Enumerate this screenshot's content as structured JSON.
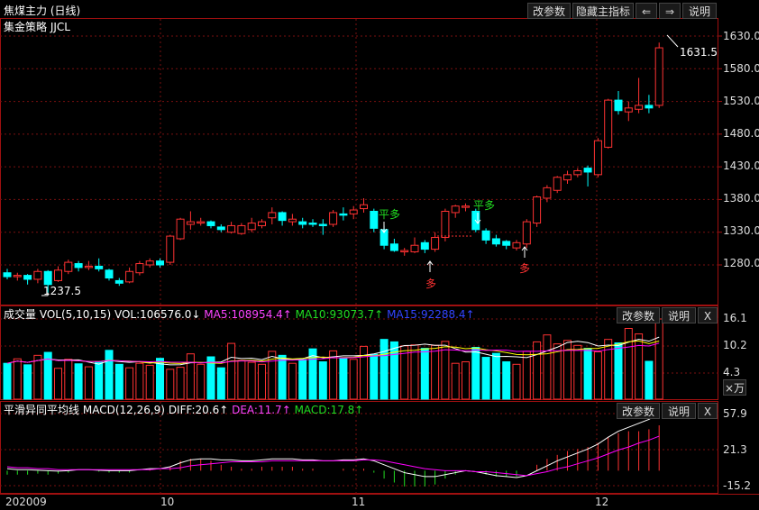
{
  "header": {
    "title": "焦煤主力 (日线)",
    "strategy": "集金策略 JJCL",
    "buttons": [
      "改参数",
      "隐藏主指标",
      "⇐",
      "⇒",
      "说明"
    ]
  },
  "price_axis": {
    "ticks": [
      "1630.0",
      "1580.0",
      "1530.0",
      "1480.0",
      "1430.0",
      "1380.0",
      "1330.0",
      "1280.0"
    ]
  },
  "annotations": {
    "high_label": "1631.5",
    "low_label": "1237.5",
    "signals": [
      {
        "text": "平多",
        "type": "exit"
      },
      {
        "text": "平多",
        "type": "exit"
      },
      {
        "text": "多",
        "type": "long"
      },
      {
        "text": "多",
        "type": "long"
      }
    ]
  },
  "volume_panel": {
    "title": "成交量",
    "indicator": "VOL(5,10,15)",
    "vol": "VOL:106576.0↓",
    "ma5": "MA5:108954.4↑",
    "ma10": "MA10:93073.7↑",
    "ma15": "MA15:92288.4↑",
    "buttons": [
      "改参数",
      "说明",
      "X"
    ],
    "ticks": [
      "16.1",
      "10.2",
      "4.3"
    ],
    "unit": "×万"
  },
  "macd_panel": {
    "title": "平滑异同平均线",
    "indicator": "MACD(12,26,9)",
    "diff": "DIFF:20.6↑",
    "dea": "DEA:11.7↑",
    "macd": "MACD:17.8↑",
    "buttons": [
      "改参数",
      "说明",
      "X"
    ],
    "ticks": [
      "57.9",
      "21.3",
      "-15.2"
    ]
  },
  "date_axis": {
    "labels": [
      "202009",
      "10",
      "11",
      "12"
    ]
  },
  "colors": {
    "up": "#ff3232",
    "down": "#00ffff",
    "ma5": "#ffffff",
    "ma10": "#ffff00",
    "ma15": "#ff00ff",
    "diff": "#ffffff",
    "dea": "#ff00ff",
    "grid": "#7a1010"
  },
  "chart_data": {
    "type": "candlestick",
    "price_range": [
      1230,
      1650
    ],
    "candles": [
      [
        1268,
        1262,
        1274,
        1258
      ],
      [
        1262,
        1264,
        1268,
        1256
      ],
      [
        1264,
        1258,
        1266,
        1250
      ],
      [
        1258,
        1270,
        1274,
        1252
      ],
      [
        1270,
        1250,
        1272,
        1237.5
      ],
      [
        1256,
        1272,
        1278,
        1254
      ],
      [
        1270,
        1284,
        1288,
        1266
      ],
      [
        1282,
        1276,
        1286,
        1270
      ],
      [
        1276,
        1278,
        1286,
        1272
      ],
      [
        1278,
        1274,
        1290,
        1270
      ],
      [
        1272,
        1260,
        1274,
        1256
      ],
      [
        1256,
        1252,
        1260,
        1248
      ],
      [
        1254,
        1270,
        1276,
        1252
      ],
      [
        1268,
        1282,
        1286,
        1264
      ],
      [
        1280,
        1286,
        1290,
        1276
      ],
      [
        1286,
        1280,
        1290,
        1276
      ],
      [
        1284,
        1324,
        1326,
        1280
      ],
      [
        1320,
        1350,
        1352,
        1318
      ],
      [
        1342,
        1346,
        1362,
        1334
      ],
      [
        1344,
        1346,
        1352,
        1340
      ],
      [
        1346,
        1340,
        1348,
        1336
      ],
      [
        1338,
        1334,
        1342,
        1330
      ],
      [
        1330,
        1340,
        1346,
        1328
      ],
      [
        1328,
        1340,
        1344,
        1326
      ],
      [
        1334,
        1344,
        1352,
        1330
      ],
      [
        1340,
        1346,
        1350,
        1336
      ],
      [
        1352,
        1360,
        1368,
        1342
      ],
      [
        1360,
        1348,
        1362,
        1340
      ],
      [
        1346,
        1350,
        1358,
        1340
      ],
      [
        1346,
        1342,
        1352,
        1336
      ],
      [
        1344,
        1342,
        1350,
        1338
      ],
      [
        1342,
        1340,
        1350,
        1326
      ],
      [
        1342,
        1360,
        1364,
        1338
      ],
      [
        1358,
        1356,
        1368,
        1348
      ],
      [
        1358,
        1364,
        1370,
        1350
      ],
      [
        1366,
        1372,
        1382,
        1360
      ],
      [
        1362,
        1336,
        1366,
        1330
      ],
      [
        1334,
        1310,
        1340,
        1304
      ],
      [
        1312,
        1302,
        1320,
        1300
      ],
      [
        1300,
        1302,
        1306,
        1294
      ],
      [
        1300,
        1310,
        1322,
        1298
      ],
      [
        1314,
        1304,
        1318,
        1298
      ],
      [
        1304,
        1322,
        1330,
        1300
      ],
      [
        1322,
        1362,
        1366,
        1316
      ],
      [
        1360,
        1370,
        1372,
        1352
      ],
      [
        1368,
        1370,
        1374,
        1362
      ],
      [
        1362,
        1334,
        1366,
        1330
      ],
      [
        1332,
        1318,
        1336,
        1312
      ],
      [
        1320,
        1312,
        1326,
        1308
      ],
      [
        1316,
        1310,
        1318,
        1304
      ],
      [
        1306,
        1314,
        1318,
        1302
      ],
      [
        1312,
        1346,
        1350,
        1306
      ],
      [
        1344,
        1384,
        1386,
        1338
      ],
      [
        1382,
        1398,
        1402,
        1376
      ],
      [
        1394,
        1414,
        1416,
        1390
      ],
      [
        1410,
        1418,
        1424,
        1404
      ],
      [
        1418,
        1424,
        1428,
        1414
      ],
      [
        1428,
        1422,
        1432,
        1400
      ],
      [
        1418,
        1470,
        1474,
        1414
      ],
      [
        1460,
        1532,
        1534,
        1458
      ],
      [
        1532,
        1516,
        1546,
        1510
      ],
      [
        1514,
        1520,
        1530,
        1500
      ],
      [
        1518,
        1524,
        1566,
        1512
      ],
      [
        1524,
        1520,
        1540,
        1512
      ],
      [
        1524,
        1612,
        1620,
        1520
      ]
    ],
    "volumes": [
      7.2,
      8.1,
      6.9,
      8.8,
      9.4,
      6.2,
      8.0,
      7.1,
      6.5,
      7.4,
      9.8,
      7.0,
      6.3,
      7.2,
      6.8,
      8.2,
      6.0,
      6.4,
      9.1,
      7.0,
      8.5,
      6.3,
      11.2,
      7.8,
      7.4,
      7.0,
      9.6,
      8.8,
      7.2,
      8.0,
      10.1,
      7.5,
      9.7,
      8.2,
      8.0,
      10.6,
      9.0,
      12.0,
      11.5,
      10.7,
      10.9,
      10.2,
      10.8,
      11.6,
      7.2,
      7.5,
      10.4,
      8.4,
      9.2,
      7.5,
      7.0,
      9.6,
      11.5,
      12.9,
      11.1,
      11.8,
      10.8,
      10.2,
      9.5,
      12.0,
      11.3,
      14.2,
      13.1,
      7.6,
      16.1
    ],
    "macd": {
      "diff": [
        2,
        1,
        1,
        0.5,
        0,
        -0.5,
        0,
        1,
        1,
        0.5,
        0,
        0,
        0,
        1,
        2,
        2,
        4,
        8,
        11,
        12,
        12,
        11,
        11,
        10,
        10,
        11,
        12,
        12,
        12,
        11,
        11,
        10,
        10,
        11,
        11,
        12,
        10,
        6,
        2,
        -2,
        -4,
        -6,
        -6,
        -4,
        -2,
        0,
        -1,
        -3,
        -5,
        -6,
        -7,
        -5,
        0,
        5,
        10,
        14,
        18,
        22,
        27,
        34,
        40,
        44,
        48,
        52,
        58
      ],
      "dea": [
        4,
        3,
        3,
        2,
        2,
        1,
        1,
        1,
        1,
        1,
        1,
        1,
        1,
        1,
        1,
        2,
        2,
        3,
        5,
        6,
        7,
        8,
        9,
        9,
        9,
        9,
        10,
        10,
        10,
        10,
        10,
        10,
        10,
        10,
        10,
        11,
        11,
        10,
        8,
        6,
        4,
        2,
        1,
        0,
        0,
        0,
        -1,
        -1,
        -2,
        -3,
        -4,
        -5,
        -3,
        -1,
        2,
        4,
        7,
        10,
        13,
        17,
        21,
        24,
        28,
        31,
        35
      ],
      "range": [
        -15.2,
        57.9
      ]
    },
    "dates": [
      "202009",
      "10",
      "11",
      "12"
    ]
  }
}
